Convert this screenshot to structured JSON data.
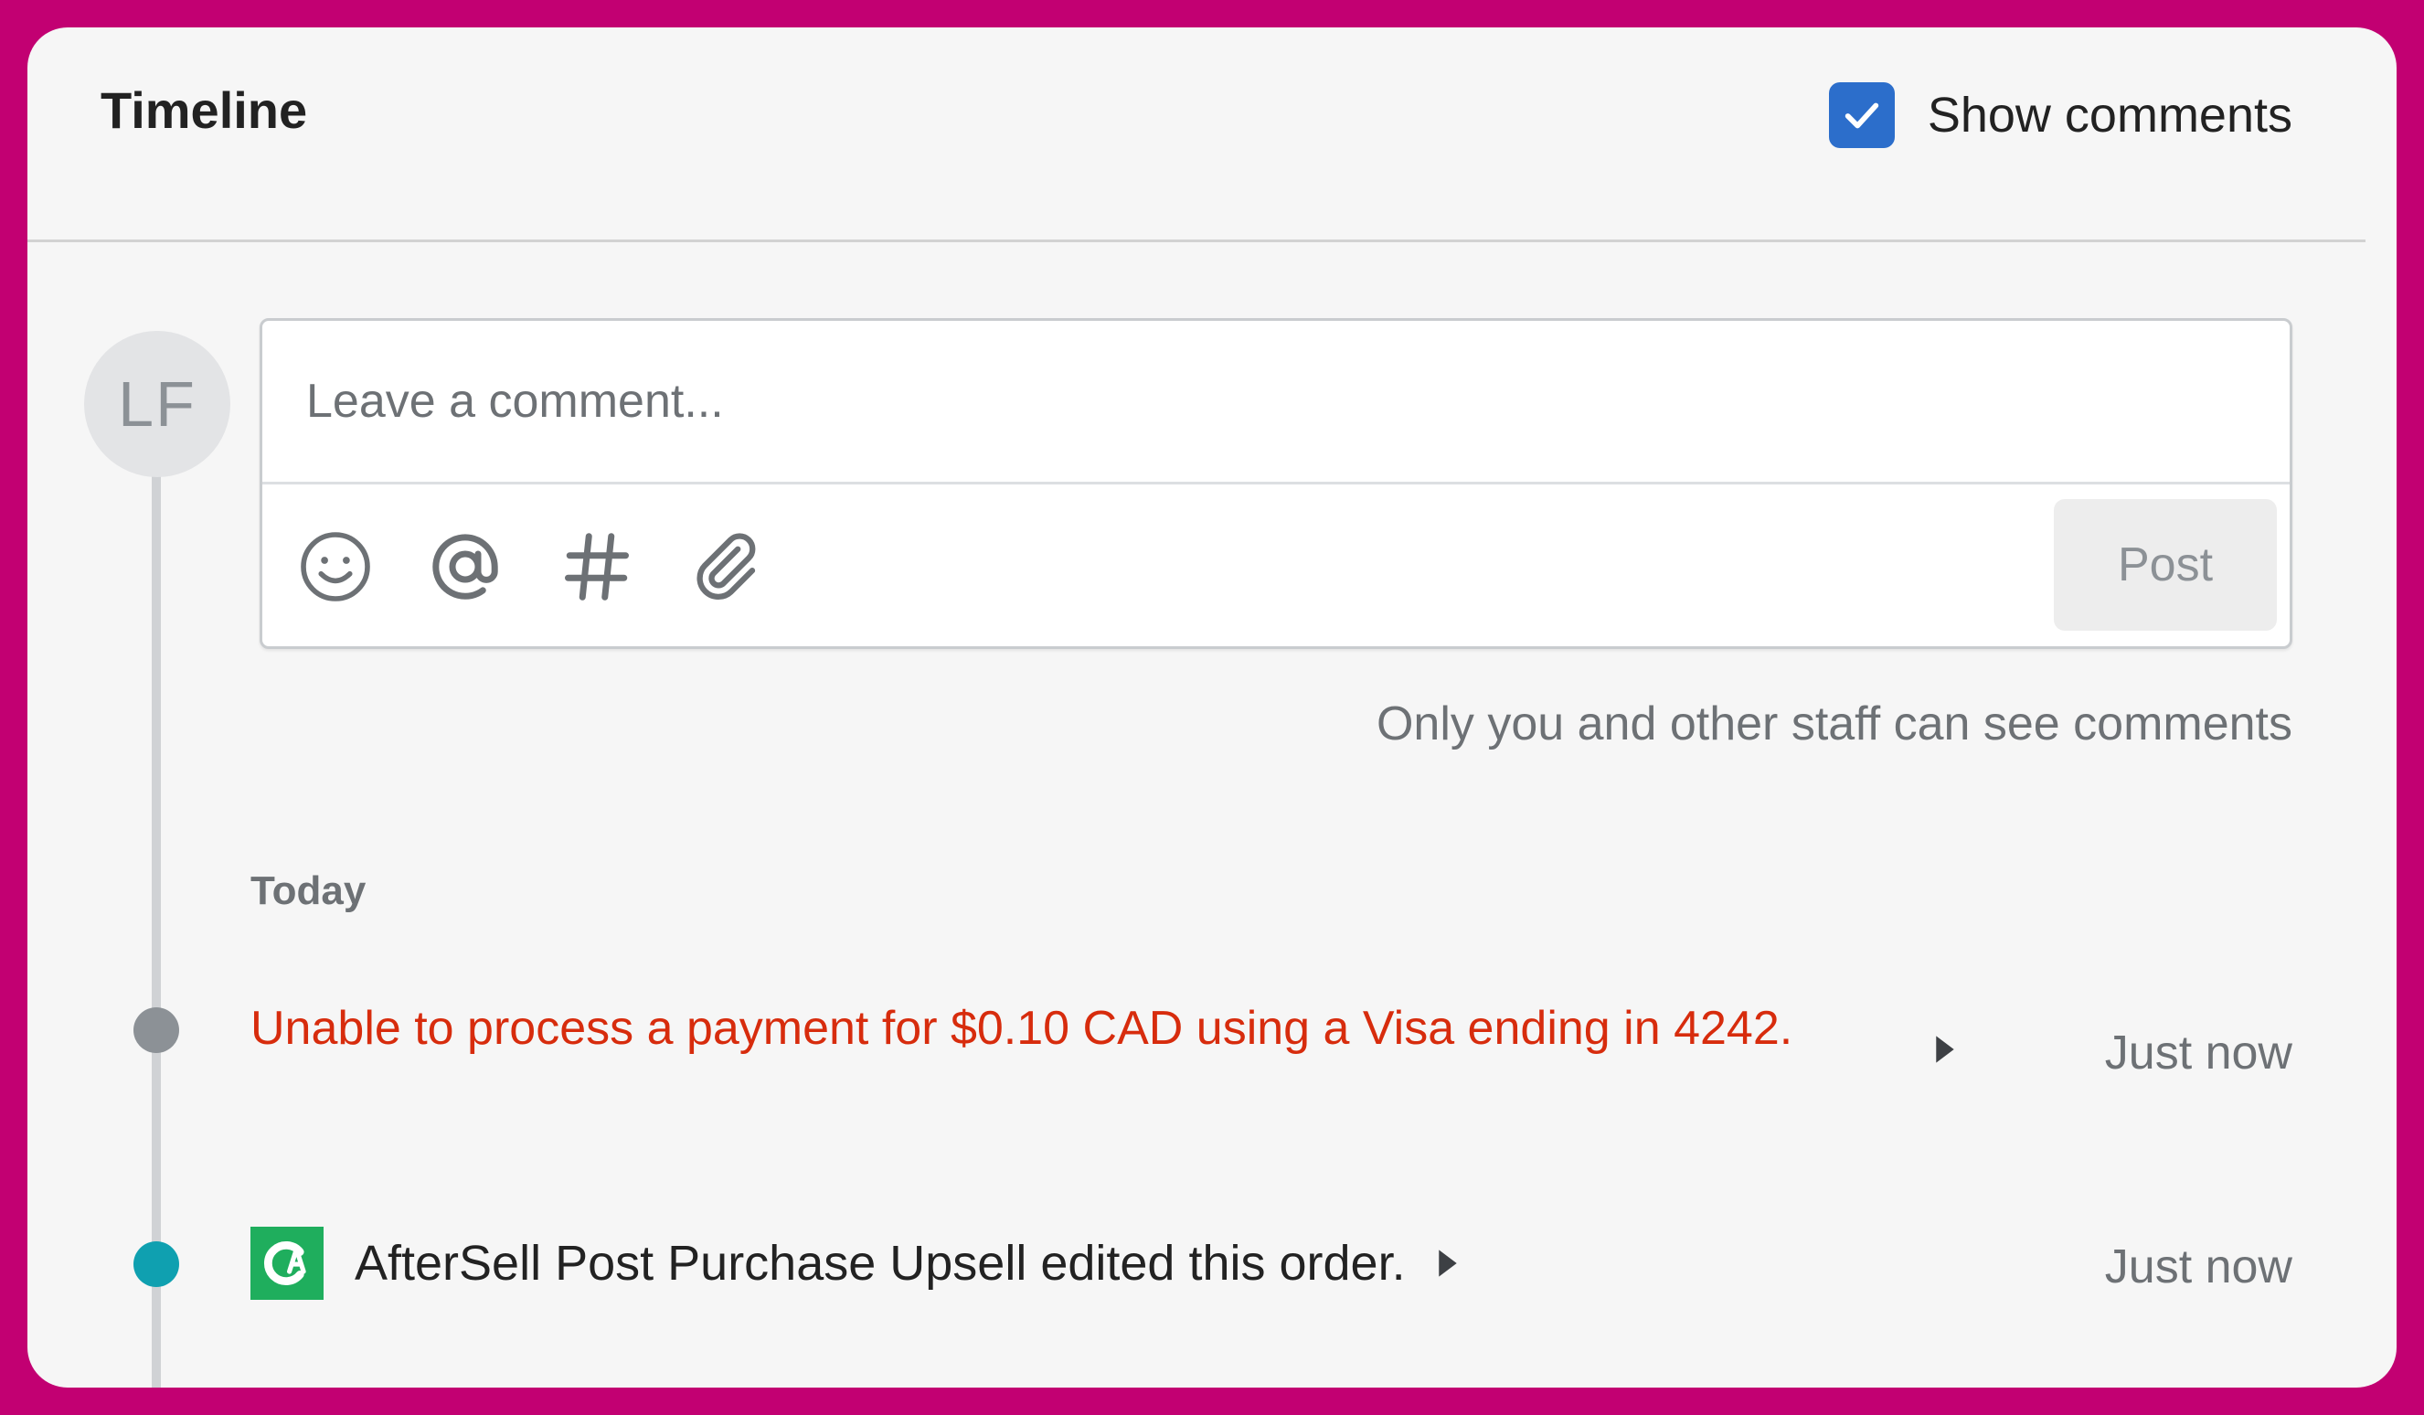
{
  "header": {
    "title": "Timeline",
    "show_comments_label": "Show comments",
    "show_comments_checked": true
  },
  "composer": {
    "avatar_initials": "LF",
    "placeholder": "Leave a comment...",
    "tools": [
      "emoji-icon",
      "mention-icon",
      "hashtag-icon",
      "attachment-icon"
    ],
    "post_label": "Post",
    "staff_note": "Only you and other staff can see comments"
  },
  "timeline": {
    "date_heading": "Today",
    "events": [
      {
        "text": "Unable to process a payment for $0.10 CAD using a Visa ending in 4242.",
        "time": "Just now",
        "dot_color": "#8c9196",
        "text_color": "#d72c0d"
      },
      {
        "app_icon": "aftersell-logo-icon",
        "text": "AfterSell Post Purchase Upsell edited this order.",
        "time": "Just now",
        "dot_color": "#0fa0b0"
      }
    ]
  },
  "colors": {
    "frame": "#c20072",
    "card": "#f6f6f6",
    "accent": "#2c6ecb",
    "error": "#d72c0d",
    "app_green": "#1fae5d"
  }
}
